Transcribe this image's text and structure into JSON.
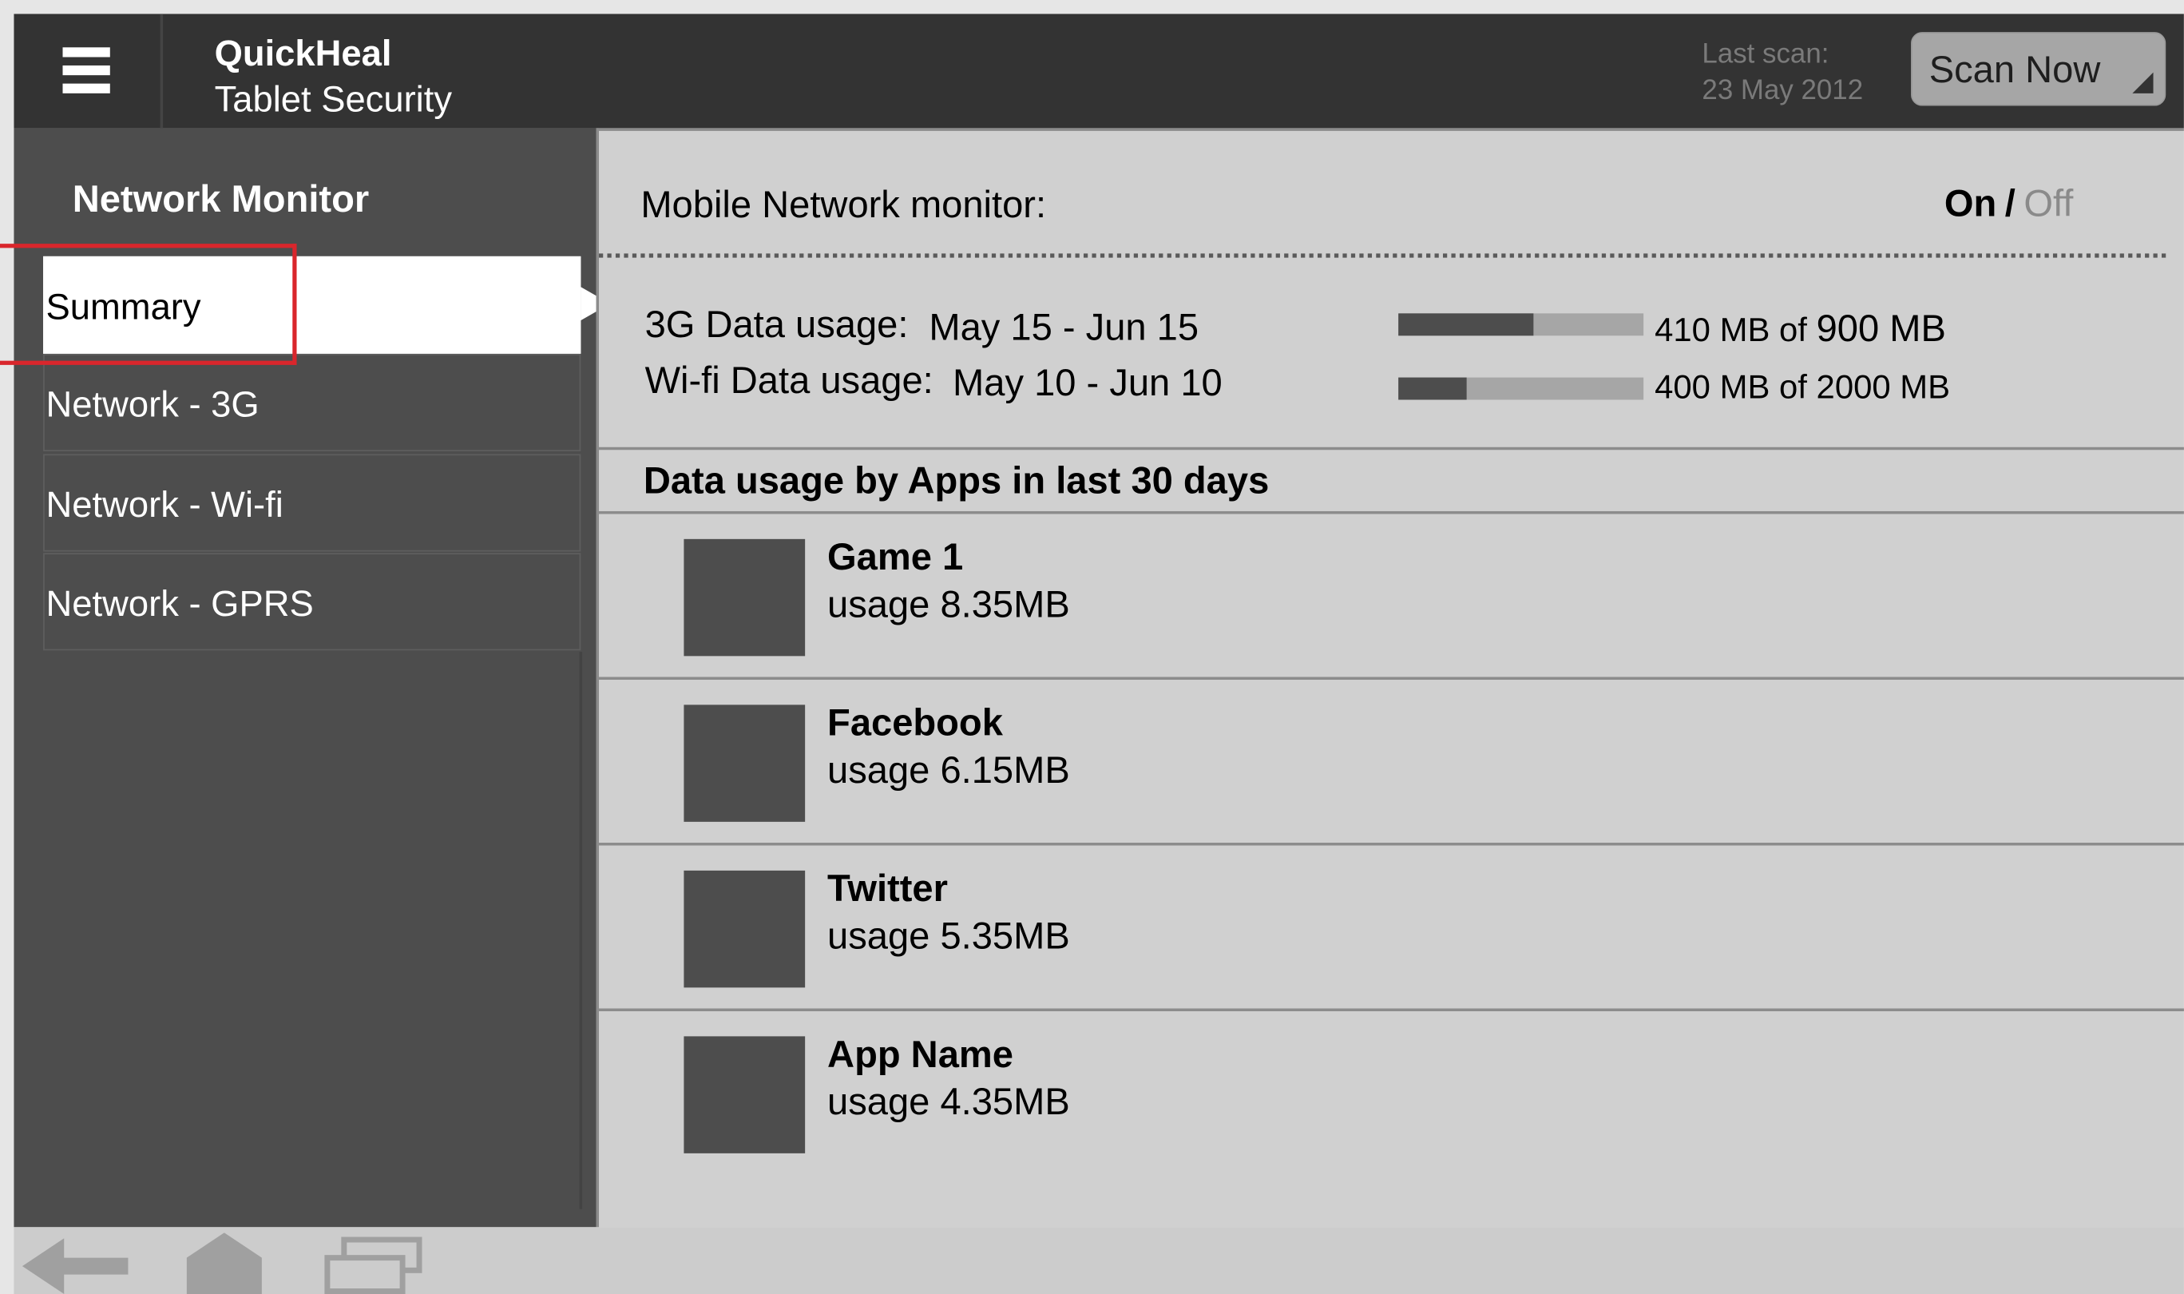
{
  "header": {
    "app_name": "QuickHeal",
    "app_subtitle": "Tablet Security",
    "last_scan_label": "Last scan:",
    "last_scan_date": "23 May 2012",
    "scan_button": "Scan Now"
  },
  "sidebar": {
    "title": "Network Monitor",
    "items": [
      {
        "label": "Summary",
        "active": true
      },
      {
        "label": "Network - 3G",
        "active": false
      },
      {
        "label": "Network - Wi-fi",
        "active": false
      },
      {
        "label": "Network - GPRS",
        "active": false
      }
    ]
  },
  "monitor": {
    "label": "Mobile Network monitor:",
    "on_label": "On",
    "separator": "/",
    "off_label": "Off",
    "state": "On"
  },
  "usage": [
    {
      "label": "3G Data usage:",
      "range": "May 15 - Jun 15",
      "used_text": "410 MB of",
      "total_text": "900 MB",
      "fraction": 0.55
    },
    {
      "label": "Wi-fi Data usage:",
      "range": "May 10 - Jun 10",
      "used_text": "400 MB of 2000 MB",
      "fraction": 0.28
    }
  ],
  "apps_heading": "Data usage by Apps in last 30 days",
  "apps": [
    {
      "name": "Game 1",
      "usage": "usage 8.35MB"
    },
    {
      "name": "Facebook",
      "usage": "usage 6.15MB"
    },
    {
      "name": "Twitter",
      "usage": "usage 5.35MB"
    },
    {
      "name": "App Name",
      "usage": "usage 4.35MB"
    }
  ],
  "nav_icons": [
    "back-arrow-icon",
    "home-icon",
    "recent-apps-icon"
  ],
  "colors": {
    "header_bg": "#333333",
    "sidebar_bg": "#4d4d4d",
    "content_bg": "#d0d0d0",
    "highlight": "#d9262c"
  }
}
